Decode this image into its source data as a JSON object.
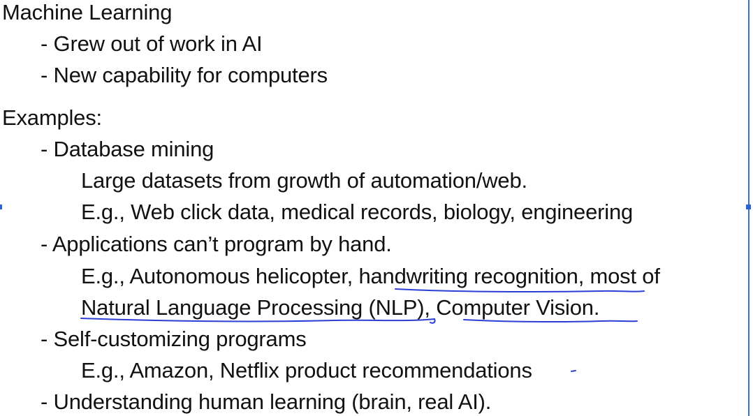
{
  "slide": {
    "heading": "Machine Learning",
    "intro_points": [
      "- Grew out of work in AI",
      "- New capability for computers"
    ],
    "examples_heading": "Examples:",
    "database_mining": {
      "title": "- Database mining",
      "details": [
        "Large datasets from growth of automation/web.",
        "E.g., Web click data, medical records, biology, engineering"
      ]
    },
    "applications": {
      "title": "- Applications can’t program by hand.",
      "detail_line1_prefix": "E.g., Autonomous helicopter, ",
      "detail_line1_highlight": "handwriting recognition",
      "detail_line1_suffix": ", most of",
      "detail_line2_highlight1": "Natural Language Processing (NLP)",
      "detail_line2_sep": ", ",
      "detail_line2_highlight2": "Computer Vision",
      "detail_line2_suffix": "."
    },
    "self_customizing": {
      "title": "- Self-customizing programs",
      "detail": "E.g., Amazon, Netflix product recommendations"
    },
    "understanding": {
      "title": "- Understanding human learning (brain, real AI)."
    }
  },
  "colors": {
    "text": "#111111",
    "annotation_ink": "#2b3fd6",
    "selection_frame": "#3b6fd4"
  }
}
